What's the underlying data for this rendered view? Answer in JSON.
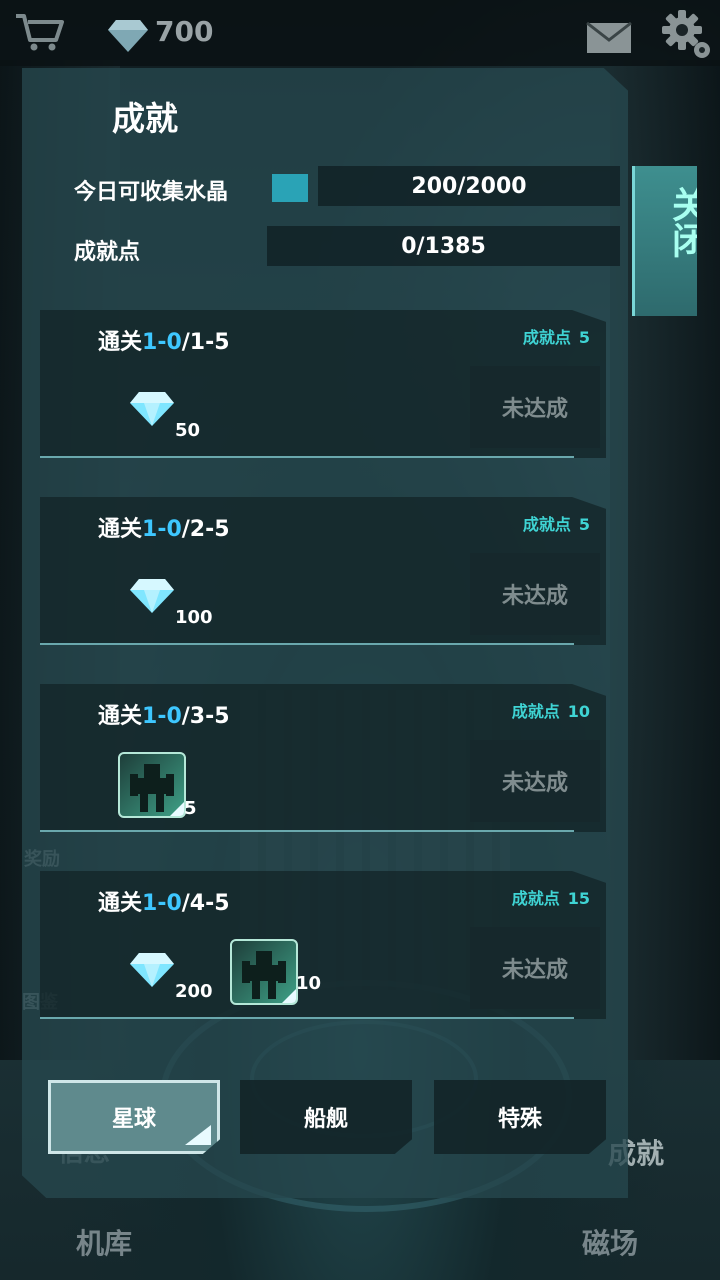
{
  "topbar": {
    "gem_count": "700"
  },
  "background_labels": {
    "reward": "奖励",
    "atlas": "图鉴",
    "info": "信息",
    "achievement": "成就",
    "hangar": "机库",
    "magnetic": "磁场"
  },
  "panel": {
    "title": "成就",
    "close_label": "关闭",
    "crystal_label": "今日可收集水晶",
    "crystal_value": "200/2000",
    "points_label": "成就点",
    "points_value": "0/1385"
  },
  "achievements": [
    {
      "title_prefix": "通关",
      "title_hl": "1-0",
      "title_suffix": "/1-5",
      "points_label": "成就点",
      "points": "5",
      "gem_qty": "50",
      "status": "未达成"
    },
    {
      "title_prefix": "通关",
      "title_hl": "1-0",
      "title_suffix": "/2-5",
      "points_label": "成就点",
      "points": "5",
      "gem_qty": "100",
      "status": "未达成"
    },
    {
      "title_prefix": "通关",
      "title_hl": "1-0",
      "title_suffix": "/3-5",
      "points_label": "成就点",
      "points": "10",
      "mech_qty": "5",
      "status": "未达成"
    },
    {
      "title_prefix": "通关",
      "title_hl": "1-0",
      "title_suffix": "/4-5",
      "points_label": "成就点",
      "points": "15",
      "gem_qty": "200",
      "mech_qty": "10",
      "status": "未达成"
    }
  ],
  "tabs": [
    {
      "label": "星球",
      "active": true
    },
    {
      "label": "船舰",
      "active": false
    },
    {
      "label": "特殊",
      "active": false
    }
  ],
  "colors": {
    "accent": "#3ec7ff",
    "points": "#3fd4d4",
    "close_text": "#a8fff0"
  }
}
